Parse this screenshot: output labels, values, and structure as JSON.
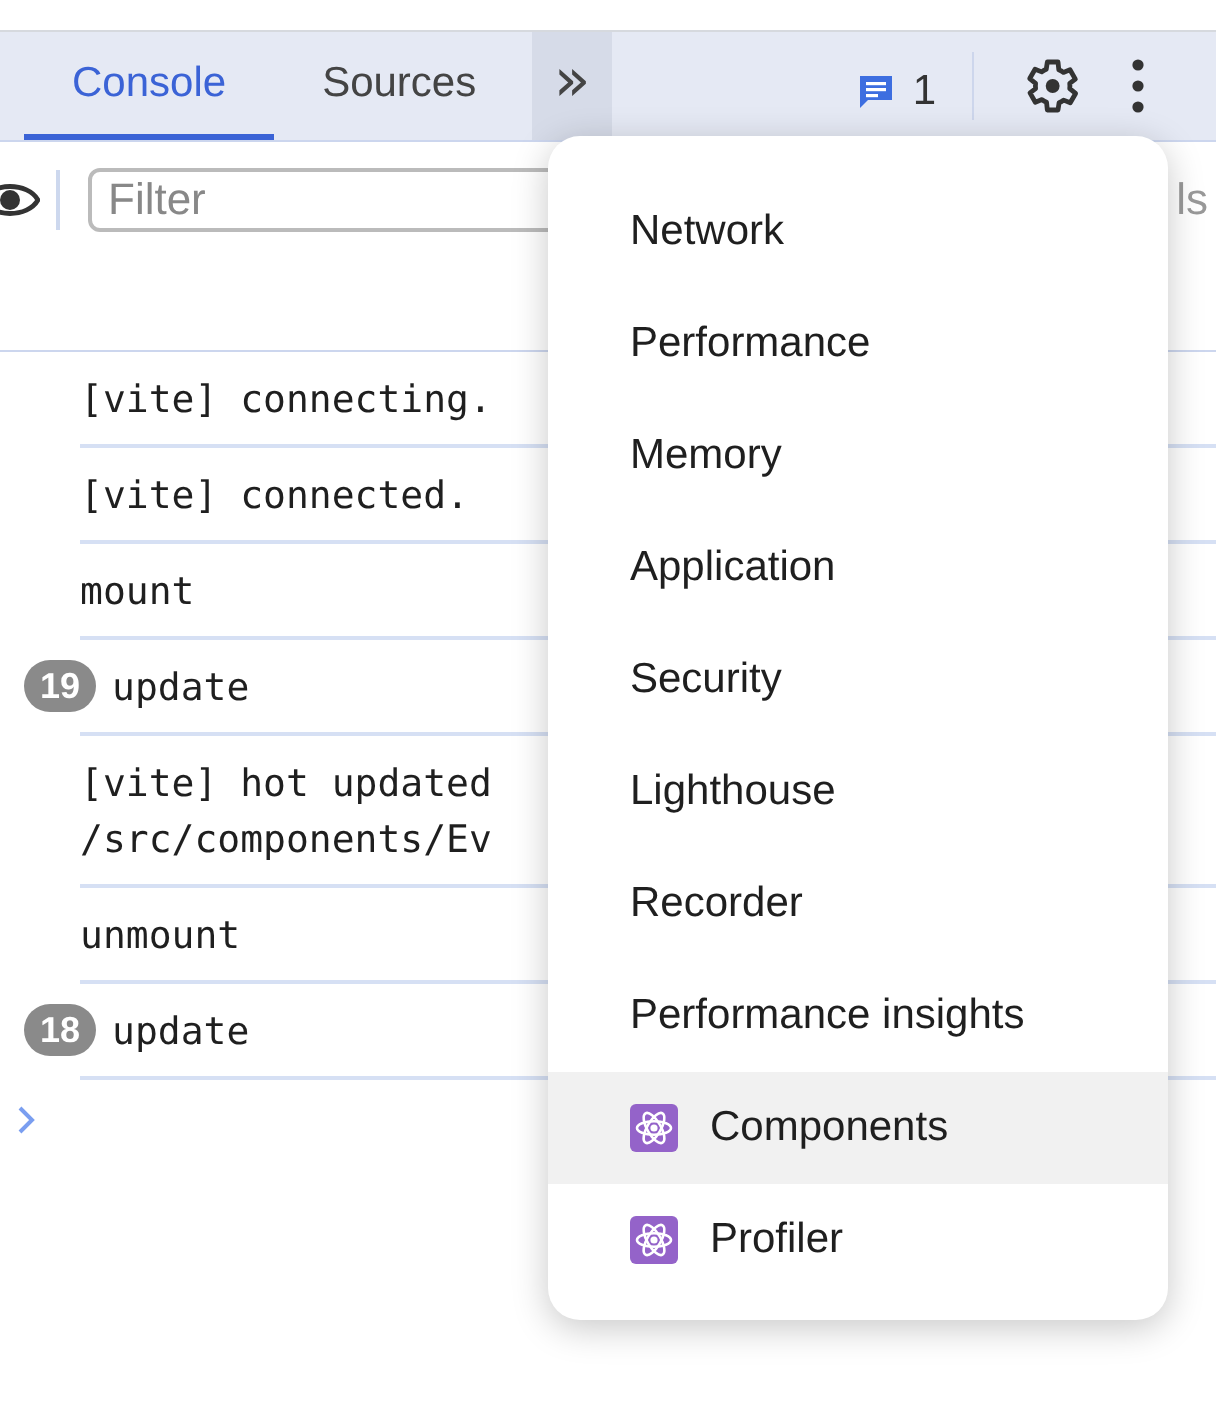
{
  "tabs": [
    {
      "label": "Console",
      "selected": true
    },
    {
      "label": "Sources",
      "selected": false
    }
  ],
  "more_tabs_button": {
    "label": "»",
    "expanded": true
  },
  "issues": {
    "count": "1"
  },
  "toolbar": {
    "filter": {
      "placeholder": "Filter"
    },
    "levels": {
      "label": "ls"
    }
  },
  "console": {
    "rows": [
      {
        "message": "[vite] connecting."
      },
      {
        "message": "[vite] connected."
      },
      {
        "message": "mount"
      },
      {
        "count": "19",
        "message": "update"
      },
      {
        "message": "[vite] hot updated",
        "message_line_2": "/src/components/Ev"
      },
      {
        "message": "unmount"
      },
      {
        "count": "18",
        "message": "update"
      }
    ]
  },
  "menu": {
    "items": [
      {
        "kind": "panel",
        "label": "Network",
        "selected": false
      },
      {
        "kind": "panel",
        "label": "Performance",
        "selected": false
      },
      {
        "kind": "panel",
        "label": "Memory",
        "selected": false
      },
      {
        "kind": "panel",
        "label": "Application",
        "selected": false
      },
      {
        "kind": "panel",
        "label": "Security",
        "selected": false
      },
      {
        "kind": "panel",
        "label": "Lighthouse",
        "selected": false
      },
      {
        "kind": "panel",
        "label": "Recorder",
        "selected": false
      },
      {
        "kind": "panel",
        "label": "Performance insights",
        "selected": false
      },
      {
        "kind": "extension",
        "label": "Components",
        "selected": true
      },
      {
        "kind": "extension",
        "label": "Profiler",
        "selected": false
      }
    ]
  }
}
